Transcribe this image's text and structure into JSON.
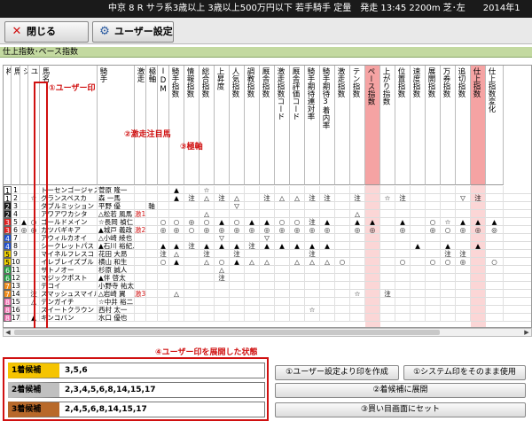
{
  "window": {
    "title": "中京 8 R サラ系3歳以上 3歳以上500万円以下 若手騎手 定量　発走 13:45 2200m 芝･左　　2014年1"
  },
  "toolbar": {
    "close_label": "閉じる",
    "user_settings_label": "ユーザー設定"
  },
  "section": {
    "title": "仕上指数･ペース指数"
  },
  "annotations": {
    "user_mark": "①ユーザー印",
    "gekisou": "②激走注目馬",
    "gokujiku": "③極軸",
    "expanded": "④ユーザー印を展開した状態"
  },
  "columns": {
    "waku": "枠",
    "uma": "馬",
    "shi": "シ",
    "yu": "ユ",
    "horse": "馬名",
    "jockey": "騎手",
    "gekisou": "激走",
    "gokujiku": "極軸",
    "idm": "IDM",
    "kishu_shisu": "騎手指数",
    "joho_shisu": "情報指数",
    "sogo_shisu": "総合指数",
    "joshodo": "上昇度",
    "ninki_shisu": "人気指数",
    "chokyo_shisu": "調教指数",
    "kyusha_shisu": "厩舎指数",
    "gekisou_code": "激走指数コード",
    "kyusha_hyoka": "厩舎評価コード",
    "kishu_kitai_rentai": "騎手期待連対率",
    "kishu_kitai_3": "騎手期待3着内率",
    "gekisou_shisu": "激走指数",
    "ten_shisu": "テン指数",
    "pace_shisu": "ペース指数",
    "agari_shisu": "上がり指数",
    "ichi_shisu": "位置指数",
    "sokudo_shisu": "速度指数",
    "tenkai_shisu": "展開指数",
    "mankenn_shisu": "万券指数",
    "chishi_shisu": "追切指数",
    "shiage_shisu": "仕上指数",
    "shiage_shisu_henka": "仕上指数変化"
  },
  "horses": [
    {
      "waku": "1",
      "uma": "1",
      "shi": "",
      "yu": "",
      "name": "トーセンゴージャス",
      "jockey": "菅原 隆一",
      "gekisou": "",
      "gokujiku": "",
      "marks": [
        "",
        "▲",
        "",
        "☆",
        "",
        "",
        "",
        "",
        "",
        "",
        "",
        "",
        "",
        "",
        "",
        "",
        "",
        "",
        "",
        "",
        "",
        "",
        ""
      ]
    },
    {
      "waku": "1",
      "uma": "2",
      "shi": "",
      "yu": "☆",
      "name": "グランスペスカ",
      "jockey": "森 一馬",
      "gekisou": "",
      "gokujiku": "",
      "marks": [
        "",
        "▲",
        "注",
        "△",
        "注",
        "△",
        "",
        "注",
        "△",
        "△",
        "注",
        "注",
        "",
        "注",
        "",
        "☆",
        "注",
        "",
        "",
        "",
        "▽",
        "注",
        ""
      ]
    },
    {
      "waku": "2",
      "uma": "3",
      "shi": "",
      "yu": "",
      "name": "ダブルミッション",
      "jockey": "平野 優",
      "gekisou": "",
      "gokujiku": "軸",
      "marks": [
        "",
        "",
        "",
        "",
        "",
        "▽",
        "",
        "",
        "",
        "",
        "",
        "",
        "",
        "",
        "",
        "",
        "",
        "",
        "",
        "",
        "",
        "",
        ""
      ]
    },
    {
      "waku": "2",
      "uma": "4",
      "shi": "",
      "yu": "",
      "name": "アワアワカシタ",
      "jockey": "△松若 風馬",
      "gekisou": "激1",
      "gokujiku": "",
      "marks": [
        "",
        "",
        "",
        "△",
        "",
        "",
        "",
        "",
        "",
        "",
        "",
        "",
        "",
        "△",
        "",
        "",
        "",
        "",
        "",
        "",
        "",
        "",
        ""
      ]
    },
    {
      "waku": "3",
      "uma": "5",
      "shi": "▲",
      "yu": "○",
      "name": "ゴールドメイン",
      "jockey": "☆長岡 禎仁",
      "gekisou": "",
      "gokujiku": "",
      "marks": [
        "○",
        "○",
        "◎",
        "○",
        "▲",
        "○",
        "▲",
        "▲",
        "○",
        "○",
        "注",
        "▲",
        "",
        "▲",
        "▲",
        "",
        "▲",
        "",
        "○",
        "☆",
        "▲",
        "▲",
        "▲"
      ]
    },
    {
      "waku": "3",
      "uma": "6",
      "shi": "◎",
      "yu": "◎",
      "name": "カツバギキア",
      "jockey": "▲城戸 義政",
      "gekisou": "激2",
      "gokujiku": "",
      "marks": [
        "◎",
        "◎",
        "○",
        "◎",
        "◎",
        "◎",
        "◎",
        "◎",
        "◎",
        "◎",
        "◎",
        "◎",
        "",
        "◎",
        "◎",
        "",
        "◎",
        "",
        "◎",
        "○",
        "◎",
        "◎",
        "◎"
      ]
    },
    {
      "waku": "4",
      "uma": "7",
      "shi": "",
      "yu": "",
      "name": "アウィルカオイ",
      "jockey": "△小崎 綾也",
      "gekisou": "",
      "gokujiku": "",
      "marks": [
        "",
        "",
        "",
        "",
        "▽",
        "",
        "",
        "▽",
        "",
        "",
        "",
        "",
        "",
        "",
        "",
        "",
        "",
        "",
        "",
        "",
        "",
        "",
        ""
      ]
    },
    {
      "waku": "4",
      "uma": "8",
      "shi": "",
      "yu": "",
      "name": "シークレットパス",
      "jockey": "▲石川 裕紀人",
      "gekisou": "",
      "gokujiku": "",
      "marks": [
        "▲",
        "▲",
        "注",
        "▲",
        "▲",
        "▲",
        "注",
        "▲",
        "▲",
        "▲",
        "▲",
        "▲",
        "",
        "",
        "",
        "",
        "",
        "▲",
        "",
        "▲",
        "",
        "▲",
        ""
      ]
    },
    {
      "waku": "5",
      "uma": "9",
      "shi": "",
      "yu": "",
      "name": "マイネルフレスコ",
      "jockey": "花田 大昂",
      "gekisou": "",
      "gokujiku": "",
      "marks": [
        "注",
        "△",
        "",
        "注",
        "",
        "注",
        "",
        "",
        "",
        "",
        "注",
        "",
        "",
        "",
        "",
        "",
        "",
        "",
        "",
        "注",
        "注",
        "",
        ""
      ]
    },
    {
      "waku": "5",
      "uma": "10",
      "shi": "",
      "yu": "",
      "name": "イレブレイズブル",
      "jockey": "横山 和生",
      "gekisou": "",
      "gokujiku": "",
      "marks": [
        "○",
        "▲",
        "",
        "△",
        "○",
        "▲",
        "△",
        "△",
        "",
        "△",
        "△",
        "△",
        "○",
        "",
        "",
        "",
        "○",
        "",
        "○",
        "○",
        "◎",
        "",
        "○"
      ]
    },
    {
      "waku": "6",
      "uma": "11",
      "shi": "",
      "yu": "",
      "name": "サトノオー",
      "jockey": "杉原 誠人",
      "gekisou": "",
      "gokujiku": "",
      "marks": [
        "",
        "",
        "",
        "",
        "△",
        "",
        "",
        "",
        "",
        "",
        "",
        "",
        "",
        "",
        "",
        "",
        "",
        "",
        "",
        "",
        "",
        "",
        ""
      ]
    },
    {
      "waku": "6",
      "uma": "12",
      "shi": "",
      "yu": "",
      "name": "マジックポスト",
      "jockey": "▲伴 啓太",
      "gekisou": "",
      "gokujiku": "",
      "marks": [
        "",
        "",
        "",
        "",
        "注",
        "",
        "",
        "",
        "",
        "",
        "",
        "",
        "",
        "",
        "",
        "",
        "",
        "",
        "",
        "",
        "",
        "",
        ""
      ]
    },
    {
      "waku": "7",
      "uma": "13",
      "shi": "",
      "yu": "",
      "name": "デコイ",
      "jockey": "小野寺 祐太",
      "gekisou": "",
      "gokujiku": "",
      "marks": [
        "",
        "",
        "",
        "",
        "",
        "",
        "",
        "",
        "",
        "",
        "",
        "",
        "",
        "",
        "",
        "",
        "",
        "",
        "",
        "",
        "",
        "",
        ""
      ]
    },
    {
      "waku": "7",
      "uma": "14",
      "shi": "",
      "yu": "注",
      "name": "スマッシュスマイル",
      "jockey": "△岩崎 翼",
      "gekisou": "激3",
      "gokujiku": "",
      "marks": [
        "",
        "△",
        "",
        "",
        "",
        "",
        "",
        "",
        "",
        "",
        "",
        "",
        "",
        "☆",
        "",
        "注",
        "",
        "",
        "",
        "",
        "",
        "",
        ""
      ]
    },
    {
      "waku": "8",
      "uma": "15",
      "shi": "",
      "yu": "△",
      "name": "テンガイチ",
      "jockey": "☆中井 裕二",
      "gekisou": "",
      "gokujiku": "",
      "marks": [
        "",
        "",
        "",
        "",
        "",
        "",
        "",
        "",
        "",
        "",
        "",
        "",
        "",
        "",
        "",
        "",
        "",
        "",
        "",
        "",
        "",
        "",
        ""
      ]
    },
    {
      "waku": "8",
      "uma": "16",
      "shi": "",
      "yu": "",
      "name": "スイートクラウン",
      "jockey": "西村 太一",
      "gekisou": "",
      "gokujiku": "",
      "marks": [
        "",
        "",
        "",
        "",
        "",
        "",
        "",
        "",
        "",
        "",
        "☆",
        "",
        "",
        "",
        "",
        "",
        "",
        "",
        "",
        "",
        "",
        "",
        ""
      ]
    },
    {
      "waku": "8",
      "uma": "17",
      "shi": "",
      "yu": "▲",
      "name": "キンコバン",
      "jockey": "水口 優也",
      "gekisou": "",
      "gokujiku": "",
      "marks": [
        "",
        "",
        "",
        "",
        "",
        "",
        "",
        "",
        "",
        "",
        "",
        "",
        "",
        "",
        "",
        "",
        "",
        "",
        "",
        "",
        "",
        "",
        ""
      ]
    }
  ],
  "candidates": [
    {
      "label": "1着候補",
      "values": "3,5,6",
      "color": "#f5c400"
    },
    {
      "label": "2着候補",
      "values": "2,3,4,5,6,8,14,15,17",
      "color": "#c0c0c0"
    },
    {
      "label": "3着候補",
      "values": "2,4,5,6,8,14,15,17",
      "color": "#b8692a"
    }
  ],
  "buttons": {
    "create_from_user": "①ユーザー設定より印を作成",
    "use_system": "①システム印をそのまま使用",
    "expand": "②着候補に展開",
    "set_bet": "③買い目画面にセット"
  },
  "waku_colors": {
    "1": "#ffffff",
    "2": "#1a1a1a",
    "3": "#e02020",
    "4": "#2050d0",
    "5": "#f0d000",
    "6": "#20a040",
    "7": "#f08c1a",
    "8": "#f070b0"
  }
}
